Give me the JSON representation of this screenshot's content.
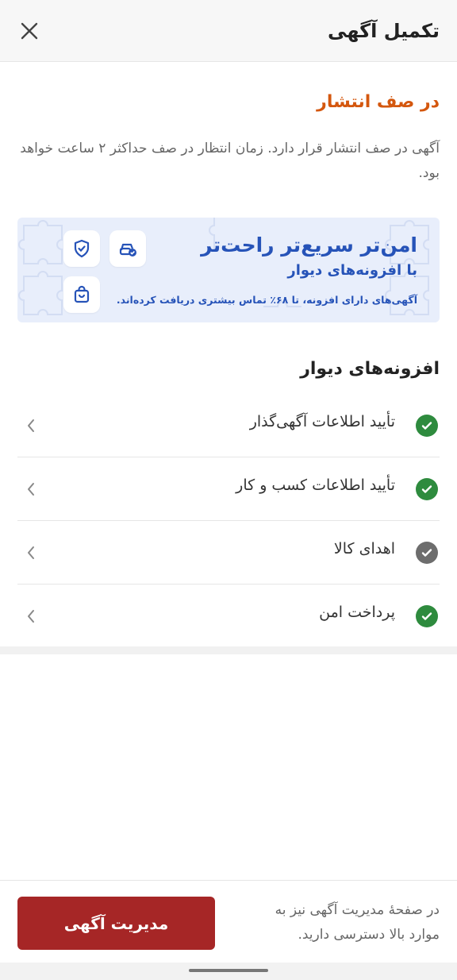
{
  "header": {
    "title": "تکمیل آگهی",
    "close_icon": "close-icon"
  },
  "status": {
    "title": "در صف انتشار",
    "description": "آگهی در صف انتشار قرار دارد. زمان انتظار در صف حداکثر ۲ ساعت خواهد بود."
  },
  "banner": {
    "title": "امن‌تر سریع‌تر راحت‌تر",
    "subtitle": "با افزونه‌های دیوار",
    "note": "آگهی‌های دارای افزونه، تا ۶۸٪ تماس بیشتری دریافت کرده‌اند.",
    "icons": [
      "car-verified-icon",
      "shield-check-icon",
      "shopping-bag-icon"
    ]
  },
  "features": {
    "title": "افزونه‌های دیوار",
    "items": [
      {
        "label": "تأیید اطلاعات آگهی‌گذار",
        "status": "done"
      },
      {
        "label": "تأیید اطلاعات کسب و کار",
        "status": "done"
      },
      {
        "label": "اهدای کالا",
        "status": "inactive"
      },
      {
        "label": "پرداخت امن",
        "status": "done"
      }
    ]
  },
  "bottom": {
    "text": "در صفحهٔ مدیریت آگهی نیز به موارد بالا دسترسی دارید.",
    "button_label": "مدیریت آگهی"
  },
  "colors": {
    "accent_orange": "#d4570e",
    "banner_blue": "#2653b8",
    "banner_bg": "#e8eefb",
    "check_green": "#2e8b3e",
    "check_gray": "#6d6d6d",
    "button_red": "#a62626"
  }
}
